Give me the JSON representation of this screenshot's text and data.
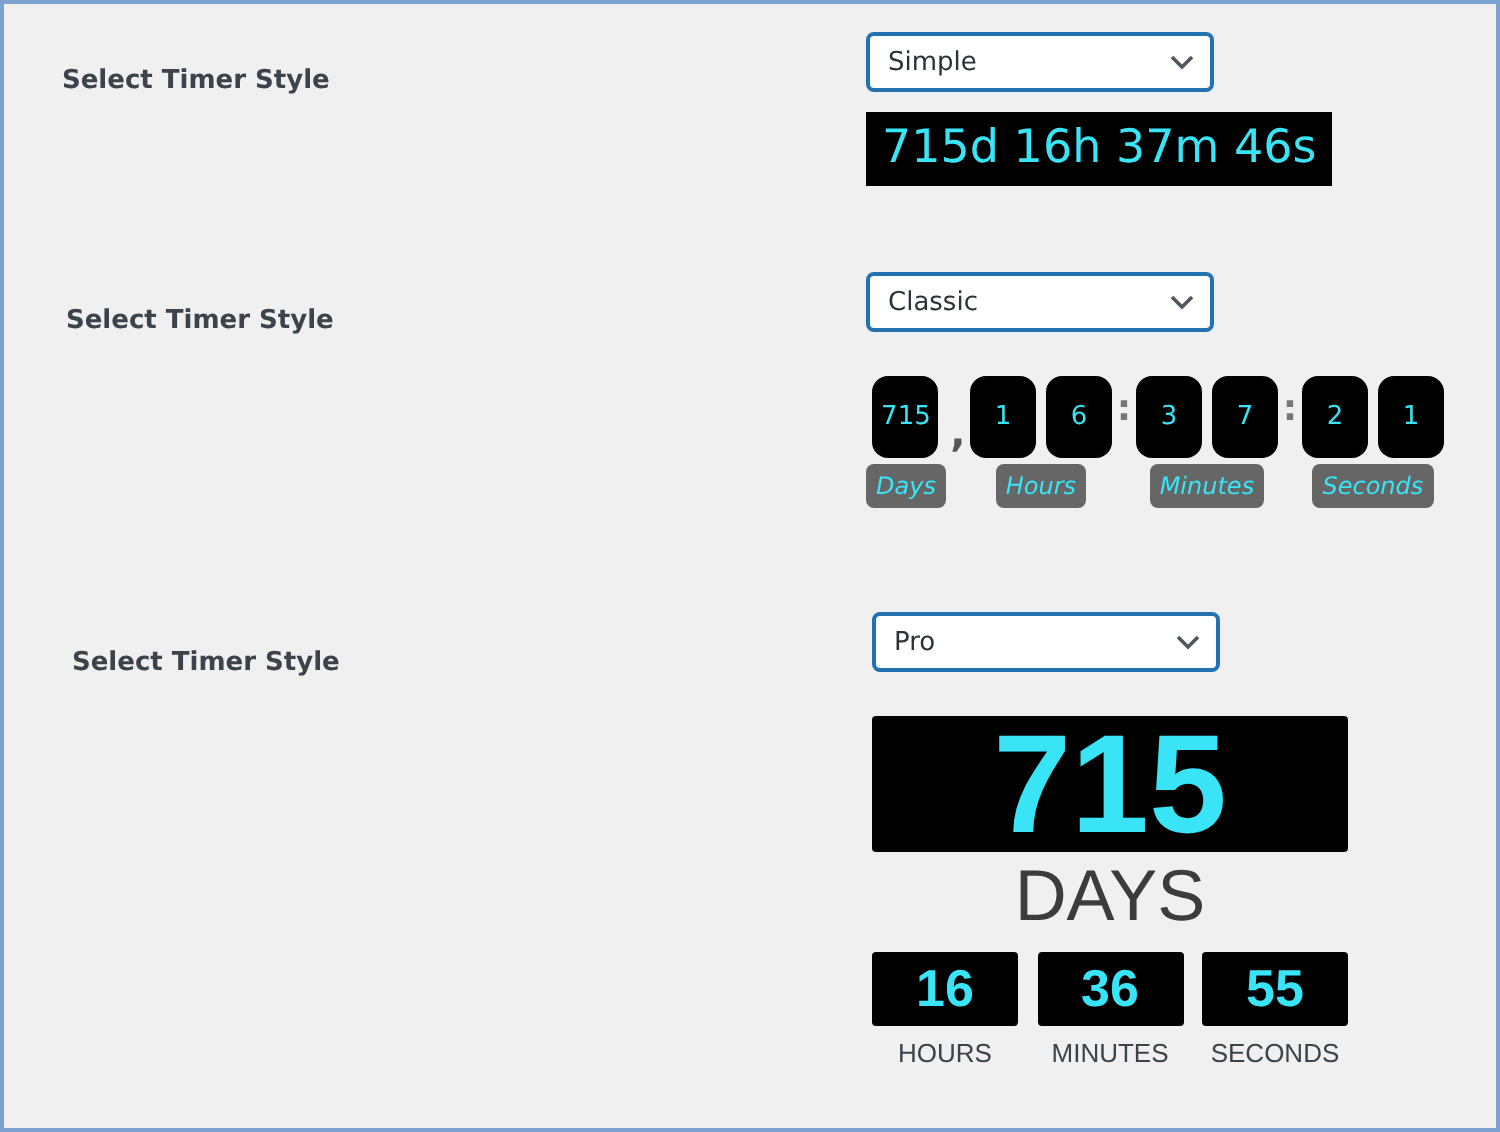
{
  "sections": [
    {
      "kind": "simple",
      "label": "Select Timer Style",
      "select": "Simple",
      "timer": "715d 16h 37m 46s"
    },
    {
      "kind": "classic",
      "label": "Select Timer Style",
      "select": "Classic",
      "groups": [
        {
          "digits": [
            "715"
          ],
          "label": "Days",
          "separator": ","
        },
        {
          "digits": [
            "1",
            "6"
          ],
          "label": "Hours",
          "separator": ":"
        },
        {
          "digits": [
            "3",
            "7"
          ],
          "label": "Minutes",
          "separator": ":"
        },
        {
          "digits": [
            "2",
            "1"
          ],
          "label": "Seconds"
        }
      ]
    },
    {
      "kind": "pro",
      "label": "Select Timer Style",
      "select": "Pro",
      "main": {
        "value": "715",
        "label": "DAYS"
      },
      "units": [
        {
          "value": "16",
          "label": "HOURS"
        },
        {
          "value": "36",
          "label": "MINUTES"
        },
        {
          "value": "55",
          "label": "SECONDS"
        }
      ]
    }
  ]
}
